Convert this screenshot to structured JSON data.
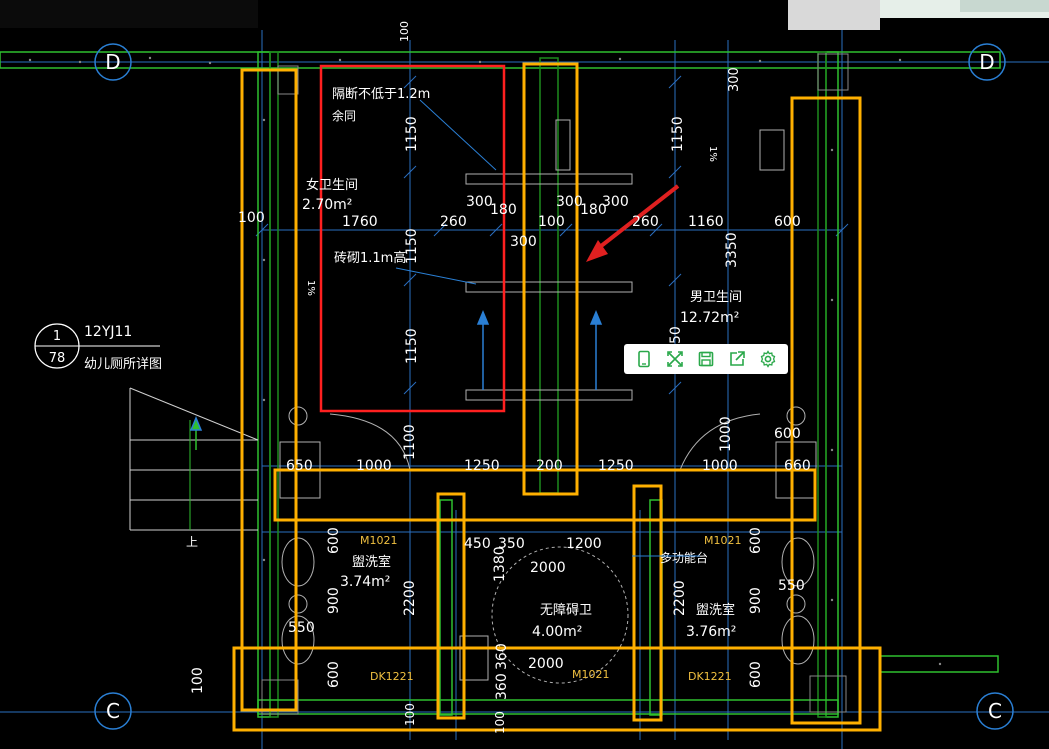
{
  "axis_labels": {
    "d_left": "D",
    "d_right": "D",
    "c_left": "C",
    "c_right": "C"
  },
  "detail_callout": {
    "num": "1",
    "sheet": "78",
    "atlas": "12YJ11",
    "caption": "幼儿厕所详图"
  },
  "rooms": {
    "female_wc": {
      "name": "女卫生间",
      "area": "2.70m²"
    },
    "male_wc": {
      "name": "男卫生间",
      "area": "12.72m²"
    },
    "wash_left": {
      "name": "盥洗室",
      "area": "3.74m²"
    },
    "wash_right": {
      "name": "盥洗室",
      "area": "3.76m²"
    },
    "accessible_wc": {
      "name": "无障碍卫",
      "area": "4.00m²"
    }
  },
  "notes": {
    "partition": "隔断不低于1.2m",
    "same": "余同",
    "brick": "砖砌1.1m高",
    "multi_platform": "多功能台"
  },
  "doors": {
    "m1021_left": "M1021",
    "m1021_right": "M1021",
    "m1021_center": "M1021",
    "dk_left": "DK1221",
    "dk_right": "DK1221"
  },
  "dims": {
    "d100_top": "100",
    "d300_top": "300",
    "d1150_a": "1150",
    "d1150_b": "1150",
    "d1150_c": "1150",
    "d1150_d": "1150",
    "d1760": "1760",
    "d260_a": "260",
    "d300_a": "300",
    "d180_a": "180",
    "d100_a": "100",
    "d300_b": "300",
    "d180_b": "180",
    "d300_c": "300",
    "d260_b": "260",
    "d1160": "1160",
    "d600_r": "600",
    "d300_mid": "300",
    "d3350": "3350",
    "d50": "50",
    "d100_left": "100",
    "d1100": "1100",
    "d1000_r": "1000",
    "d600_rr": "600",
    "d650": "650",
    "d1000_a": "1000",
    "d1250_a": "1250",
    "d200": "200",
    "d1250_b": "1250",
    "d1000_b": "1000",
    "d660": "660",
    "d600_l1": "600",
    "d900_l": "900",
    "d2200_l": "2200",
    "d550_l": "550",
    "d600_l2": "600",
    "d450": "450",
    "d350": "350",
    "d1200": "1200",
    "d1380": "1380",
    "d2000_a": "2000",
    "d2200_r": "2200",
    "d600_r1": "600",
    "d900_r": "900",
    "d550_r": "550",
    "d600_r2": "600",
    "d360_a": "360",
    "d360_b": "360",
    "d2000_b": "2000",
    "d100_bl": "100",
    "d100_bc": "100",
    "d100_bottom": "100"
  },
  "slope_marks": {
    "left": "1%",
    "right": "1%"
  },
  "stair_label": "上",
  "toolbar_icons": [
    "phone-icon",
    "fullscreen-icon",
    "save-icon",
    "share-icon",
    "settings-icon"
  ],
  "colors": {
    "highlight_orange": "#ffb000",
    "highlight_red": "#ff2020",
    "arrow_red": "#e02020",
    "wall_green": "#33cc33",
    "grid_blue": "#2a7fd4",
    "text_white": "#ffffff",
    "door_text": "#f0c040"
  }
}
